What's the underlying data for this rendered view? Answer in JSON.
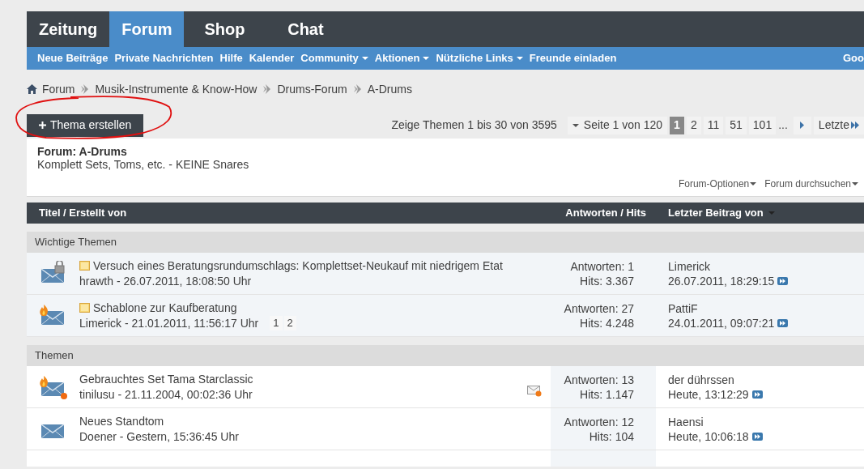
{
  "tabs": [
    {
      "label": "Zeitung",
      "selected": false
    },
    {
      "label": "Forum",
      "selected": true
    },
    {
      "label": "Shop",
      "selected": false
    },
    {
      "label": "Chat",
      "selected": false
    }
  ],
  "nav_links": [
    {
      "label": "Neue Beiträge",
      "dropdown": false
    },
    {
      "label": "Private Nachrichten",
      "dropdown": false
    },
    {
      "label": "Hilfe",
      "dropdown": false
    },
    {
      "label": "Kalender",
      "dropdown": false
    },
    {
      "label": "Community",
      "dropdown": true
    },
    {
      "label": "Aktionen",
      "dropdown": true
    },
    {
      "label": "Nützliche Links",
      "dropdown": true
    },
    {
      "label": "Freunde einladen",
      "dropdown": false
    }
  ],
  "nav_right": "Goo",
  "breadcrumb": [
    "Forum",
    "Musik-Instrumente & Know-How",
    "Drums-Forum",
    "A-Drums"
  ],
  "new_thread_button": "Thema erstellen",
  "pagination": {
    "summary": "Zeige Themen 1 bis 30 von 3595",
    "page_label": "Seite 1 von 120",
    "pages": [
      {
        "label": "1",
        "selected": true
      },
      {
        "label": "2",
        "selected": false
      },
      {
        "label": "11",
        "selected": false
      },
      {
        "label": "51",
        "selected": false
      },
      {
        "label": "101",
        "selected": false
      }
    ],
    "ellipsis": "...",
    "last": "Letzte"
  },
  "forum": {
    "title": "Forum: A-Drums",
    "description": "Komplett Sets, Toms, etc. - KEINE Snares"
  },
  "tools": [
    "Forum-Optionen",
    "Forum durchsuchen"
  ],
  "columns": {
    "title": "Titel / Erstellt von",
    "stats": "Antworten / Hits",
    "last_post": "Letzter Beitrag von"
  },
  "sections": [
    {
      "title": "Wichtige Themen",
      "kind": "sticky",
      "threads": [
        {
          "kind": "locked",
          "prefix_icon": true,
          "title": "Versuch eines Beratungsrundumschlags: Komplettset-Neukauf mit niedrigem Etat",
          "author_line": "hrawth - 26.07.2011, 18:08:50 Uhr",
          "subscribed": false,
          "replies": "Antworten: 1",
          "hits": "Hits: 3.367",
          "last_user": "Limerick",
          "last_time": "26.07.2011, 18:29:15"
        },
        {
          "kind": "hot",
          "prefix_icon": true,
          "title": "Schablone zur Kaufberatung",
          "author_line": "Limerick - 21.01.2011, 11:56:17 Uhr",
          "pages": [
            "1",
            "2"
          ],
          "subscribed": false,
          "replies": "Antworten: 27",
          "hits": "Hits: 4.248",
          "last_user": "PattiF",
          "last_time": "24.01.2011, 09:07:21"
        }
      ]
    },
    {
      "title": "Themen",
      "kind": "normal",
      "threads": [
        {
          "kind": "hot_posted",
          "prefix_icon": false,
          "title": "Gebrauchtes Set Tama Starclassic",
          "author_line": "tinilusu - 21.11.2004, 00:02:36 Uhr",
          "subscribed": true,
          "replies": "Antworten: 13",
          "hits": "Hits: 1.147",
          "last_user": "der dührssen",
          "last_time": "Heute, 13:12:29"
        },
        {
          "kind": "plain",
          "prefix_icon": false,
          "title": "Neues Standtom",
          "author_line": "Doener - Gestern, 15:36:45 Uhr",
          "subscribed": false,
          "replies": "Antworten: 12",
          "hits": "Hits: 104",
          "last_user": "Haensi",
          "last_time": "Heute, 10:06:18"
        }
      ]
    }
  ]
}
